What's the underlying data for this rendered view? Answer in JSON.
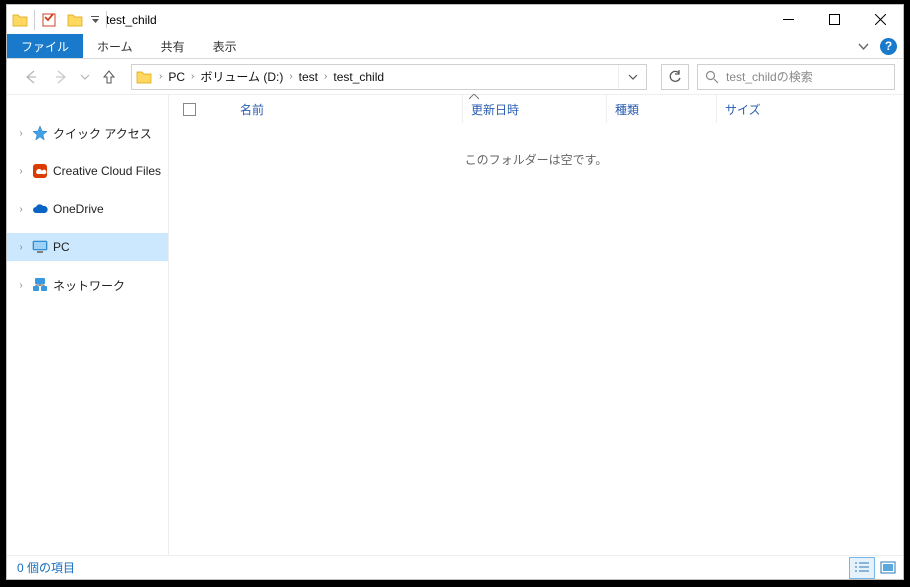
{
  "window_title": "test_child",
  "tabs": {
    "file": "ファイル",
    "home": "ホーム",
    "share": "共有",
    "view": "表示"
  },
  "breadcrumbs": [
    "PC",
    "ボリューム (D:)",
    "test",
    "test_child"
  ],
  "search": {
    "placeholder": "test_childの検索"
  },
  "sidebar": {
    "items": [
      {
        "label": "クイック アクセス",
        "icon": "star"
      },
      {
        "label": "Creative Cloud Files",
        "icon": "cc"
      },
      {
        "label": "OneDrive",
        "icon": "cloud"
      },
      {
        "label": "PC",
        "icon": "pc"
      },
      {
        "label": "ネットワーク",
        "icon": "network"
      }
    ]
  },
  "columns": {
    "name": "名前",
    "date": "更新日時",
    "type": "種類",
    "size": "サイズ"
  },
  "empty_message": "このフォルダーは空です。",
  "status": {
    "count": "0 個の項目"
  }
}
